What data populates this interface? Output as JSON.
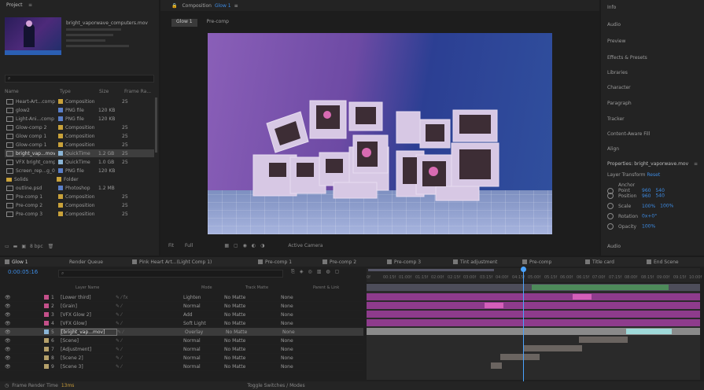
{
  "colors": {
    "accent": "#3d8be3",
    "playhead": "#4aa3ff",
    "purple": "#8e3b8c",
    "pink": "#d45fb9",
    "gray_bar": "#6a6460",
    "teal": "#9fd9d9",
    "green": "#4d8a5a"
  },
  "project": {
    "title": "Project",
    "footage_name": "bright_vaporwave_computers.mov",
    "search_placeholder": "",
    "columns": [
      "Name",
      "",
      "Type",
      "Size",
      "Frame Ra..."
    ],
    "items": [
      {
        "name": "Heart-Art...comp 1",
        "type": "Composition",
        "size": "",
        "fps": "25"
      },
      {
        "name": "glow2",
        "type": "PNG file",
        "size": "120 KB",
        "fps": ""
      },
      {
        "name": "Light-Ani...comp 1",
        "type": "PNG file",
        "size": "120 KB",
        "fps": ""
      },
      {
        "name": "Glow-comp 2",
        "type": "Composition",
        "size": "",
        "fps": "25"
      },
      {
        "name": "Glow comp 1",
        "type": "Composition",
        "size": "",
        "fps": "25"
      },
      {
        "name": "Glow-comp 1",
        "type": "Composition",
        "size": "",
        "fps": "25"
      },
      {
        "name": "bright_vap...mov",
        "type": "QuickTime",
        "size": "1.2 GB",
        "fps": "25"
      },
      {
        "name": "VFX bright_comp",
        "type": "QuickTime",
        "size": "1.0 GB",
        "fps": "25"
      },
      {
        "name": "Screen_rep...g_0",
        "type": "PNG file",
        "size": "120 KB",
        "fps": ""
      },
      {
        "name": "Solids",
        "type": "Folder",
        "size": "",
        "fps": ""
      },
      {
        "name": "outline.psd",
        "type": "Photoshop",
        "size": "1.2 MB",
        "fps": ""
      },
      {
        "name": "Pre-comp 1",
        "type": "Composition",
        "size": "",
        "fps": "25"
      },
      {
        "name": "Pre-comp 2",
        "type": "Composition",
        "size": "",
        "fps": "25"
      },
      {
        "name": "Pre-comp 3",
        "type": "Composition",
        "size": "",
        "fps": "25"
      }
    ],
    "bpc": "8 bpc"
  },
  "viewer": {
    "title": "Composition",
    "comp_name": "Glow 1",
    "tabs": [
      "Glow 1",
      "Pre-comp"
    ],
    "zoom": "Fit",
    "quality": "Full",
    "camera": "Active Camera"
  },
  "right_panel": {
    "items": [
      "Info",
      "Audio",
      "Preview",
      "Effects & Presets",
      "Libraries",
      "Character",
      "Paragraph",
      "Tracker",
      "Content-Aware Fill",
      "Align"
    ],
    "properties_title": "Properties: bright_vaporwave.mov",
    "layer_transform": "Layer Transform",
    "reset": "Reset",
    "transform": [
      {
        "label": "Anchor Point",
        "value": "960",
        "value2": "540"
      },
      {
        "label": "Position",
        "value": "960",
        "value2": "540"
      },
      {
        "label": "Scale",
        "value": "100%",
        "value2": "100%"
      },
      {
        "label": "Rotation",
        "value": "0x+0°",
        "value2": ""
      },
      {
        "label": "Opacity",
        "value": "100%",
        "value2": ""
      }
    ],
    "audio": "Audio"
  },
  "timeline": {
    "tabs": [
      "Glow 1",
      "Render Queue",
      "Pink Heart Art...(Light Comp 1)",
      "Pre-comp 1",
      "Pre-comp 2",
      "Pre-comp 3",
      "Tint adjustment",
      "Pre-comp",
      "Title card",
      "End Scene"
    ],
    "timecode": "0:00:05:16",
    "columns": {
      "name": "Layer Name",
      "mode": "Mode",
      "trkmat": "Track Matte",
      "parent": "Parent & Link"
    },
    "layers": [
      {
        "num": "1",
        "name": "[Lower third]",
        "mode": "Lighten",
        "matte": "No Matte",
        "parent": "None",
        "label": "#c4508a"
      },
      {
        "num": "2",
        "name": "[Grain]",
        "mode": "Normal",
        "matte": "No Matte",
        "parent": "None",
        "label": "#c4508a"
      },
      {
        "num": "3",
        "name": "[VFX Glow 2]",
        "mode": "Add",
        "matte": "No Matte",
        "parent": "None",
        "label": "#c4508a"
      },
      {
        "num": "4",
        "name": "[VFX Glow]",
        "mode": "Soft Light",
        "matte": "No Matte",
        "parent": "None",
        "label": "#c4508a"
      },
      {
        "num": "5",
        "name": "[bright_vap...mov]",
        "mode": "Overlay",
        "matte": "No Matte",
        "parent": "None",
        "label": "#8bb5d6"
      },
      {
        "num": "6",
        "name": "[Scene]",
        "mode": "Normal",
        "matte": "No Matte",
        "parent": "None",
        "label": "#b5a06a"
      },
      {
        "num": "7",
        "name": "[Adjustment]",
        "mode": "Normal",
        "matte": "No Matte",
        "parent": "None",
        "label": "#b5a06a"
      },
      {
        "num": "8",
        "name": "[Scene 2]",
        "mode": "Normal",
        "matte": "No Matte",
        "parent": "None",
        "label": "#b5a06a"
      },
      {
        "num": "9",
        "name": "[Scene 3]",
        "mode": "Normal",
        "matte": "No Matte",
        "parent": "None",
        "label": "#b5a06a"
      }
    ],
    "ruler": [
      "0f",
      "00:15f",
      "01:00f",
      "01:15f",
      "02:00f",
      "02:15f",
      "03:00f",
      "03:15f",
      "04:00f",
      "04:15f",
      "05:00f",
      "05:15f",
      "06:00f",
      "06:15f",
      "07:00f",
      "07:15f",
      "08:00f",
      "08:15f",
      "09:00f",
      "09:15f",
      "10:00f"
    ],
    "frame_render_time": "Frame Render Time",
    "render_time_value": "13ms",
    "toggle": "Toggle Switches / Modes",
    "playhead_fraction": 0.47
  }
}
